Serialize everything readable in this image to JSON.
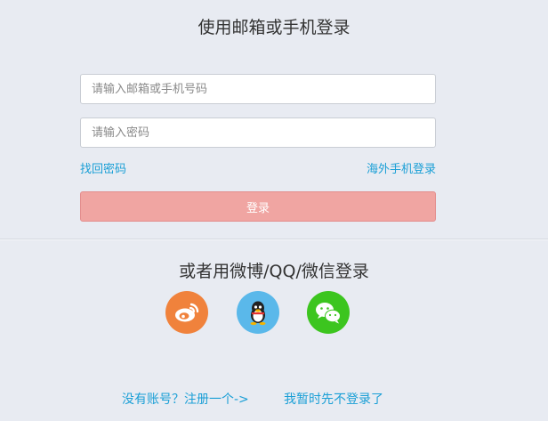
{
  "login": {
    "title": "使用邮箱或手机登录",
    "account_placeholder": "请输入邮箱或手机号码",
    "password_placeholder": "请输入密码",
    "forgot_password": "找回密码",
    "overseas_login": "海外手机登录",
    "submit_label": "登录",
    "button_color": "#f0a5a2"
  },
  "social": {
    "title": "或者用微博/QQ/微信登录",
    "providers": [
      {
        "name": "weibo",
        "icon": "weibo-icon",
        "color": "#f0823c"
      },
      {
        "name": "qq",
        "icon": "qq-penguin-icon",
        "color": "#5ab8ea"
      },
      {
        "name": "wechat",
        "icon": "wechat-icon",
        "color": "#3cc51f"
      }
    ]
  },
  "footer": {
    "register_link": "没有账号？注册一个->",
    "skip_link": "我暂时先不登录了"
  },
  "colors": {
    "background": "#e8ebf2",
    "link": "#1a9fd6"
  }
}
